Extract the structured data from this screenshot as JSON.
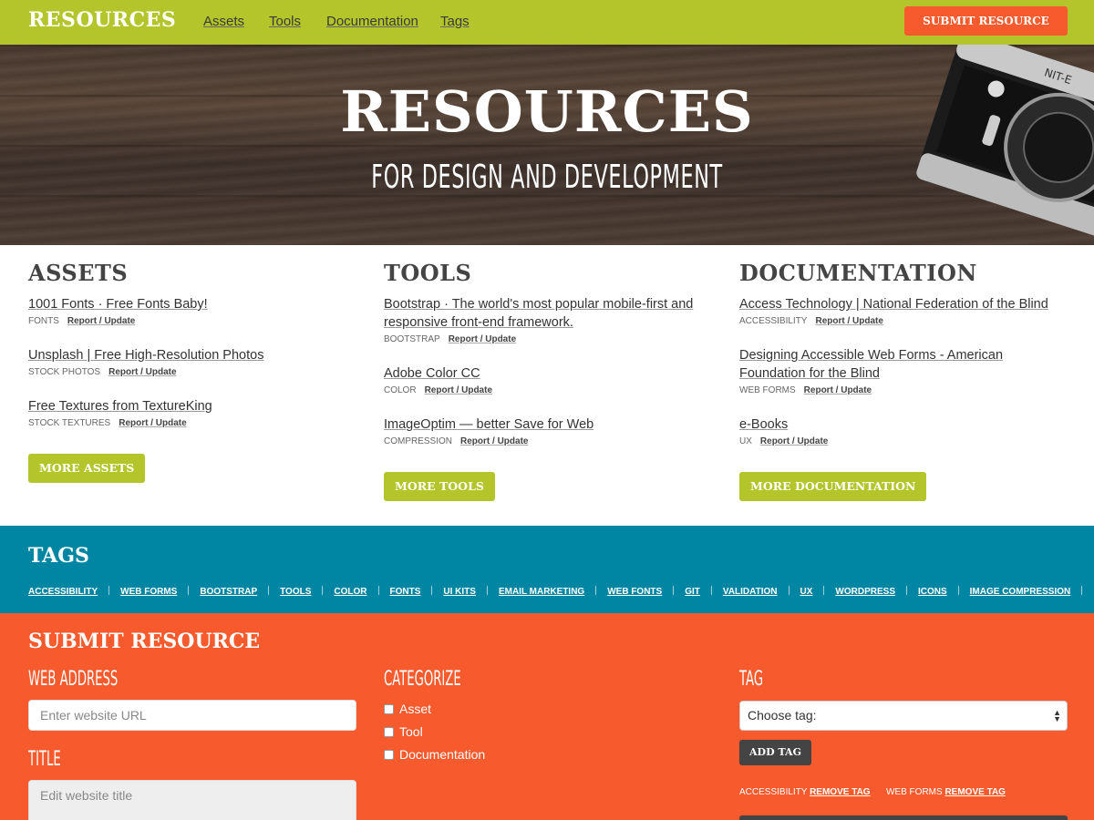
{
  "nav": {
    "brand": "RESOURCES",
    "links": [
      "Assets",
      "Tools",
      "Documentation",
      "Tags"
    ],
    "submit_label": "SUBMIT RESOURCE"
  },
  "hero": {
    "title": "RESOURCES",
    "subtitle": "FOR DESIGN AND DEVELOPMENT"
  },
  "columns": [
    {
      "heading": "ASSETS",
      "items": [
        {
          "title": "1001 Fonts · Free Fonts Baby!",
          "tag": "FONTS",
          "report": "Report / Update"
        },
        {
          "title": "Unsplash | Free High-Resolution Photos",
          "tag": "STOCK PHOTOS",
          "report": "Report / Update"
        },
        {
          "title": "Free Textures from TextureKing",
          "tag": "STOCK TEXTURES",
          "report": "Report / Update"
        }
      ],
      "more_label": "MORE ASSETS"
    },
    {
      "heading": "TOOLS",
      "items": [
        {
          "title": "Bootstrap · The world's most popular mobile-first and responsive front-end framework.",
          "tag": "BOOTSTRAP",
          "report": "Report / Update"
        },
        {
          "title": "Adobe Color CC",
          "tag": "COLOR",
          "report": "Report / Update"
        },
        {
          "title": "ImageOptim — better Save for Web",
          "tag": "COMPRESSION",
          "report": "Report / Update"
        }
      ],
      "more_label": "MORE TOOLS"
    },
    {
      "heading": "DOCUMENTATION",
      "items": [
        {
          "title": "Access Technology | National Federation of the Blind",
          "tag": "ACCESSIBILITY",
          "report": "Report / Update"
        },
        {
          "title": "Designing Accessible Web Forms - American Foundation for the Blind",
          "tag": "WEB FORMS",
          "report": "Report / Update"
        },
        {
          "title": "e-Books",
          "tag": "UX",
          "report": "Report / Update"
        }
      ],
      "more_label": "MORE DOCUMENTATION"
    }
  ],
  "tags": {
    "heading": "TAGS",
    "list": [
      "ACCESSIBILITY",
      "WEB FORMS",
      "BOOTSTRAP",
      "TOOLS",
      "COLOR",
      "FONTS",
      "UI KITS",
      "EMAIL MARKETING",
      "WEB FONTS",
      "GIT",
      "VALIDATION",
      "UX",
      "WORDPRESS",
      "ICONS",
      "IMAGE COMPRESSION"
    ]
  },
  "submit": {
    "heading": "SUBMIT RESOURCE",
    "web_address_label": "WEB ADDRESS",
    "web_address_placeholder": "Enter website URL",
    "title_label": "TITLE",
    "title_placeholder": "Edit website title",
    "categorize_label": "CATEGORIZE",
    "categories": [
      "Asset",
      "Tool",
      "Documentation"
    ],
    "tag_label": "TAG",
    "tag_select_value": "Choose tag:",
    "add_tag_label": "ADD TAG",
    "chosen_tags": [
      {
        "name": "ACCESSIBILITY",
        "remove": "REMOVE TAG"
      },
      {
        "name": "WEB FORMS",
        "remove": "REMOVE TAG"
      }
    ]
  },
  "colors": {
    "lime": "#b3c52a",
    "teal": "#0086a3",
    "orange": "#f65a2d",
    "dark": "#444444"
  }
}
